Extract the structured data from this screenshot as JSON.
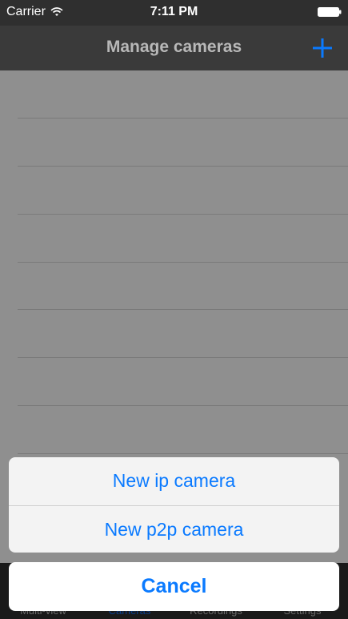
{
  "status_bar": {
    "carrier": "Carrier",
    "time": "7:11 PM",
    "wifi_icon": "wifi-icon",
    "battery_icon": "battery-icon"
  },
  "nav": {
    "title": "Manage cameras",
    "add_icon": "plus-icon",
    "accent_color": "#0a7aff"
  },
  "camera_list": {
    "rows": [
      "",
      "",
      "",
      "",
      "",
      "",
      "",
      ""
    ]
  },
  "tabs": [
    {
      "label": "Multi-view",
      "active": false
    },
    {
      "label": "Cameras",
      "active": true
    },
    {
      "label": "Recordings",
      "active": false
    },
    {
      "label": "Settings",
      "active": false
    }
  ],
  "action_sheet": {
    "items": [
      "New ip camera",
      "New p2p camera"
    ],
    "cancel": "Cancel"
  }
}
